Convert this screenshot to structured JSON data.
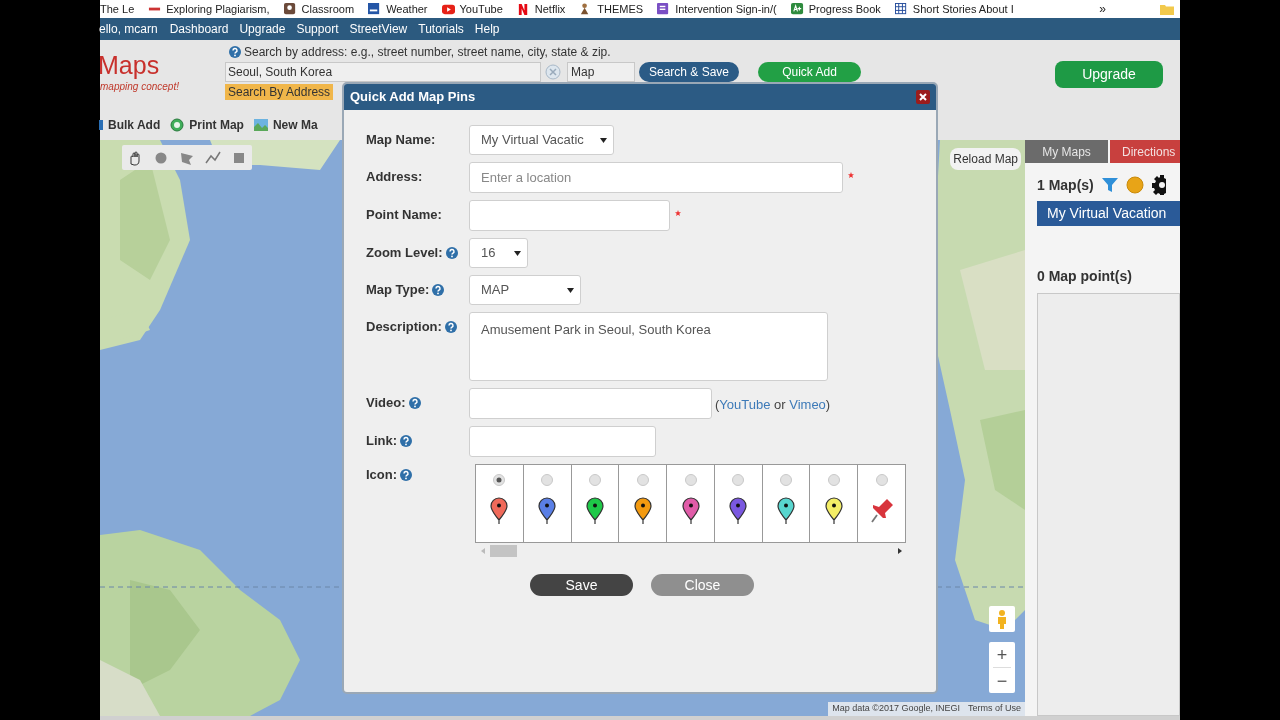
{
  "bookmarks": [
    {
      "label": "The Le"
    },
    {
      "label": "Exploring Plagiarism,"
    },
    {
      "label": "Classroom"
    },
    {
      "label": "Weather"
    },
    {
      "label": "YouTube"
    },
    {
      "label": "Netflix"
    },
    {
      "label": "THEMES"
    },
    {
      "label": "Intervention Sign-in/("
    },
    {
      "label": "Progress Book"
    },
    {
      "label": "Short Stories About I"
    }
  ],
  "bookmarks_more": "»",
  "nav": {
    "greeting": "ello, mcarn",
    "links": [
      "Dashboard",
      "Upgrade",
      "Support",
      "StreetView",
      "Tutorials",
      "Help"
    ]
  },
  "header": {
    "logo": "Maps",
    "tagline": "mapping concept!",
    "search_hint": "Search by address: e.g., street number, street name, city, state & zip.",
    "search_value": "Seoul, South Korea",
    "map_type": "Map",
    "search_button": "Search & Save",
    "quick_add": "Quick Add",
    "search_mode": "Search By Address",
    "upgrade": "Upgrade"
  },
  "toolbar": [
    {
      "label": "Bulk Add"
    },
    {
      "label": "Print Map"
    },
    {
      "label": "New Ma"
    }
  ],
  "map": {
    "reload": "Reload Map",
    "zoom_in": "+",
    "zoom_out": "−",
    "attribution": "Map data ©2017 Google, INEGI",
    "terms": "Terms of Use"
  },
  "side_panel": {
    "tabs": [
      {
        "label": "My Maps",
        "selected": true,
        "color": "#6b6b6b"
      },
      {
        "label": "Directions",
        "selected": false,
        "color": "#c8403e"
      }
    ],
    "map_count": "1 Map(s)",
    "maps": [
      {
        "label": "My Virtual Vacation",
        "selected": true
      }
    ],
    "point_count": "0 Map point(s)"
  },
  "dialog": {
    "title": "Quick Add Map Pins",
    "fields": [
      {
        "kind": "select",
        "label": "Map Name:",
        "value": "My Virtual Vacatic",
        "help": false,
        "required": false
      },
      {
        "kind": "input",
        "label": "Address:",
        "placeholder": "Enter a location",
        "help": false,
        "required": true
      },
      {
        "kind": "input",
        "label": "Point Name:",
        "help": false,
        "required": true
      },
      {
        "kind": "select",
        "label": "Zoom Level:",
        "value": "16",
        "help": true,
        "required": false
      },
      {
        "kind": "select",
        "label": "Map Type:",
        "value": "MAP",
        "help": true,
        "required": false
      },
      {
        "kind": "textarea",
        "label": "Description:",
        "value": "Amusement Park in Seoul, South Korea",
        "help": true,
        "required": false
      },
      {
        "kind": "input",
        "label": "Video:",
        "help": true,
        "required": false,
        "note": {
          "open": "(",
          "first_link": "YouTube",
          "middle": "or",
          "second_link": "Vimeo",
          "close": ")"
        }
      },
      {
        "kind": "input",
        "label": "Link:",
        "help": true,
        "required": false
      }
    ],
    "icon_label": "Icon:",
    "icon_help": true,
    "icons": [
      {
        "kind": "marker",
        "color": "#f06a5a",
        "selected": true
      },
      {
        "kind": "marker",
        "color": "#5a7fe6",
        "selected": false
      },
      {
        "kind": "marker",
        "color": "#1ec948",
        "selected": false
      },
      {
        "kind": "marker",
        "color": "#f39a10",
        "selected": false
      },
      {
        "kind": "marker",
        "color": "#e05ca8",
        "selected": false
      },
      {
        "kind": "marker",
        "color": "#7a58e0",
        "selected": false
      },
      {
        "kind": "marker",
        "color": "#58d6cf",
        "selected": false
      },
      {
        "kind": "marker",
        "color": "#f4ee66",
        "selected": false
      },
      {
        "kind": "pushpin",
        "color": "#d8343c",
        "selected": false
      }
    ],
    "buttons": [
      {
        "label": "Save",
        "kind": "primary"
      },
      {
        "label": "Close",
        "kind": "secondary"
      }
    ]
  }
}
